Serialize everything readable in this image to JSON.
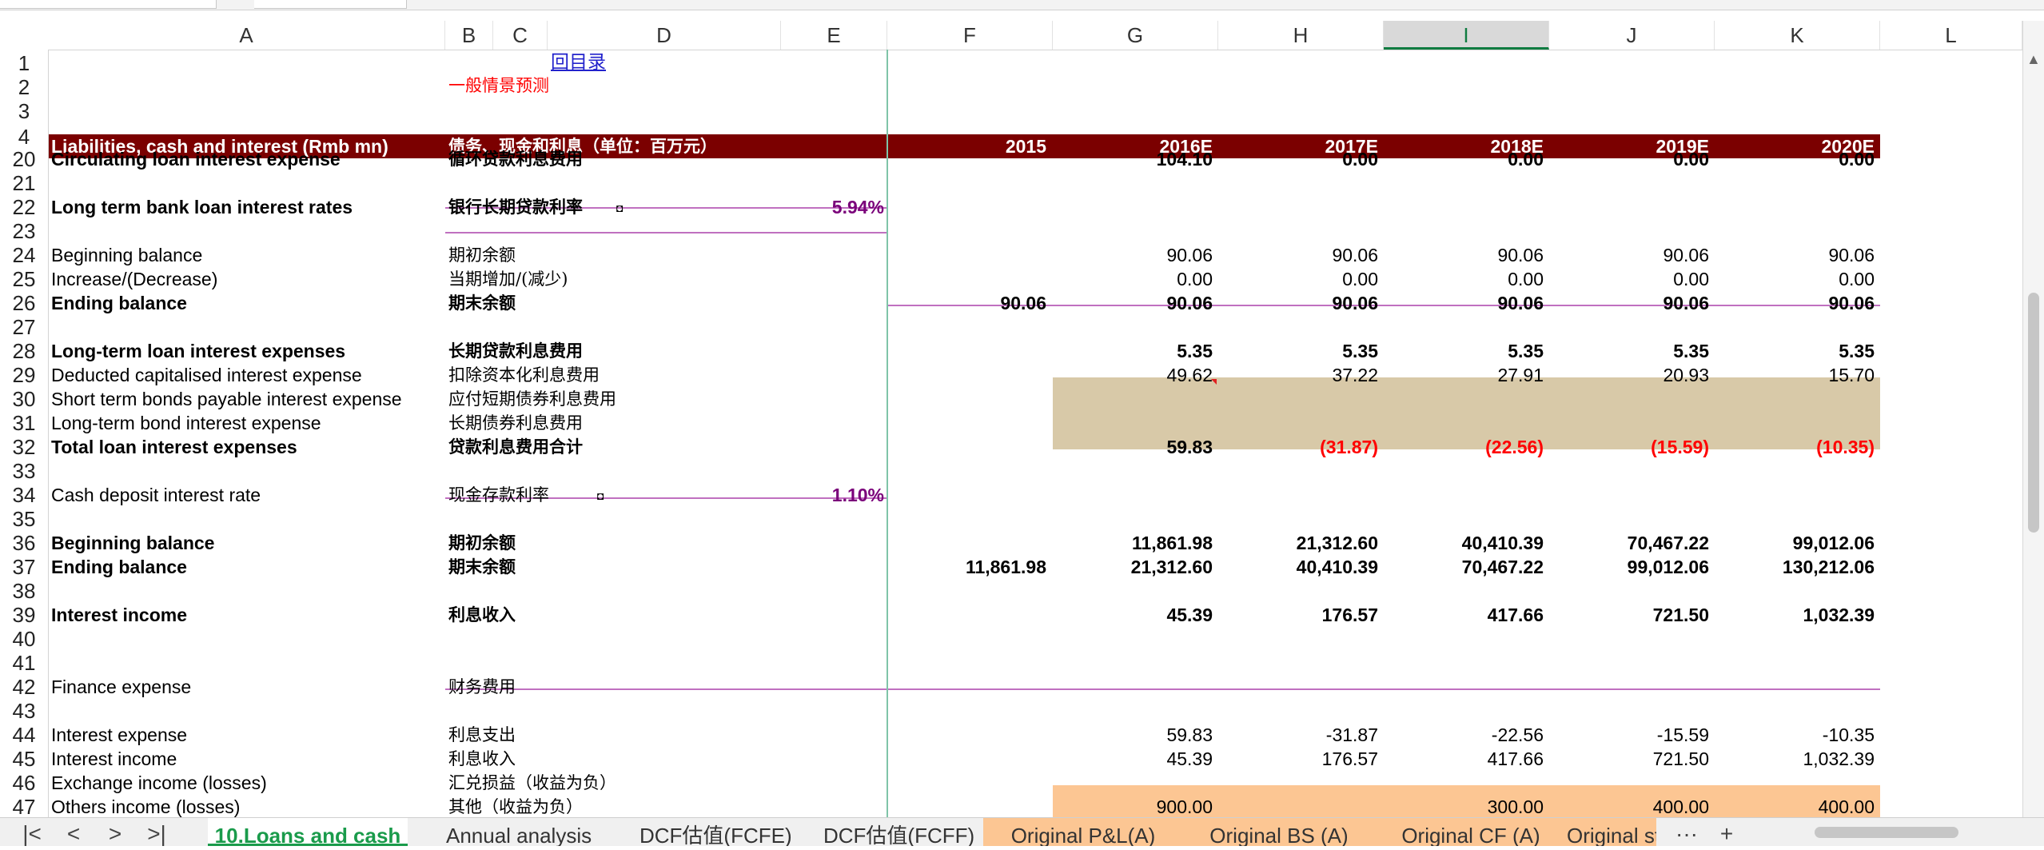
{
  "columns": [
    "A",
    "B",
    "C",
    "D",
    "E",
    "F",
    "G",
    "H",
    "I",
    "J",
    "K",
    "L"
  ],
  "selected_column": "I",
  "rows": [
    "1",
    "2",
    "3",
    "4",
    "20",
    "21",
    "22",
    "23",
    "24",
    "25",
    "26",
    "27",
    "28",
    "29",
    "30",
    "31",
    "32",
    "33",
    "34",
    "35",
    "36",
    "37",
    "38",
    "39",
    "40",
    "41",
    "42",
    "43",
    "44",
    "45",
    "46",
    "47"
  ],
  "link_text": "回目录",
  "scenario_text": "一般情景预测",
  "header": {
    "title_en": "Liabilities, cash and interest (Rmb mn)",
    "title_zh": "债务、现金和利息（单位：百万元）",
    "years": [
      "2015",
      "2016E",
      "2017E",
      "2018E",
      "2019E",
      "2020E"
    ]
  },
  "lines": [
    {
      "en": "Circulating loan interest expense",
      "zh": "循环贷款利息费用",
      "bold": true,
      "vals": [
        "",
        "104.10",
        "0.00",
        "0.00",
        "0.00",
        "0.00"
      ]
    },
    {
      "en": "Long term bank loan interest rates",
      "zh": "银行长期贷款利率",
      "rate": "5.94%",
      "bold": true
    },
    {
      "en": "Beginning balance",
      "zh": "期初余额",
      "vals": [
        "",
        "90.06",
        "90.06",
        "90.06",
        "90.06",
        "90.06"
      ]
    },
    {
      "en": "Increase/(Decrease)",
      "zh": "当期增加/(减少)",
      "vals": [
        "",
        "0.00",
        "0.00",
        "0.00",
        "0.00",
        "0.00"
      ]
    },
    {
      "en": "Ending balance",
      "zh": "期末余额",
      "bold": true,
      "vals": [
        "90.06",
        "90.06",
        "90.06",
        "90.06",
        "90.06",
        "90.06"
      ]
    },
    {
      "en": "Long-term loan interest expenses",
      "zh": "长期贷款利息费用",
      "bold": true,
      "vals": [
        "",
        "5.35",
        "5.35",
        "5.35",
        "5.35",
        "5.35"
      ]
    },
    {
      "en": "Deducted capitalised interest expense",
      "zh": "扣除资本化利息费用",
      "vals": [
        "",
        "49.62",
        "37.22",
        "27.91",
        "20.93",
        "15.70"
      ]
    },
    {
      "en": "Short term bonds payable interest expense",
      "zh": "应付短期债券利息费用"
    },
    {
      "en": "Long-term bond interest expense",
      "zh": "长期债券利息费用"
    },
    {
      "en": "Total loan interest expenses",
      "zh": "贷款利息费用合计",
      "bold": true,
      "vals": [
        "",
        "59.83",
        "(31.87)",
        "(22.56)",
        "(15.59)",
        "(10.35)"
      ]
    },
    {
      "en": "Cash deposit interest rate",
      "zh": "现金存款利率",
      "rate": "1.10%"
    },
    {
      "en": "Beginning balance",
      "zh": "期初余额",
      "bold": true,
      "vals": [
        "",
        "11,861.98",
        "21,312.60",
        "40,410.39",
        "70,467.22",
        "99,012.06"
      ]
    },
    {
      "en": "Ending balance",
      "zh": "期末余额",
      "bold": true,
      "vals": [
        "11,861.98",
        "21,312.60",
        "40,410.39",
        "70,467.22",
        "99,012.06",
        "130,212.06"
      ]
    },
    {
      "en": "Interest income",
      "zh": "利息收入",
      "bold": true,
      "vals": [
        "",
        "45.39",
        "176.57",
        "417.66",
        "721.50",
        "1,032.39"
      ]
    },
    {
      "en": "Finance expense",
      "zh": "财务费用"
    },
    {
      "en": "Interest expense",
      "zh": "利息支出",
      "vals": [
        "",
        "59.83",
        "-31.87",
        "-22.56",
        "-15.59",
        "-10.35"
      ]
    },
    {
      "en": "Interest income",
      "zh": "利息收入",
      "vals": [
        "",
        "45.39",
        "176.57",
        "417.66",
        "721.50",
        "1,032.39"
      ]
    },
    {
      "en": "Exchange income (losses)",
      "zh": "汇兑损益（收益为负）"
    },
    {
      "en": "Others income (losses)",
      "zh": "其他（收益为负）",
      "vals": [
        "",
        "900.00",
        "",
        "300.00",
        "400.00",
        "400.00"
      ]
    }
  ],
  "sheet_tabs": [
    "10.Loans and cash",
    "Annual analysis",
    "DCF估值(FCFE)",
    "DCF估值(FCFF)",
    "Original P&L(A)",
    "Original BS (A)",
    "Original CF (A)",
    "Original st"
  ],
  "active_tab": "10.Loans and cash",
  "nav": {
    "first": "|<",
    "prev": "<",
    "next": ">",
    "last": ">|",
    "more": "···",
    "add": "+"
  },
  "colors": {
    "header_band": "#7b0000",
    "tan_fill": "#d8c9a8",
    "peach_fill": "#fcc693",
    "active_tab_green": "#1a9b4b",
    "negative": "#ff0000",
    "rate_purple": "#7a007a"
  }
}
